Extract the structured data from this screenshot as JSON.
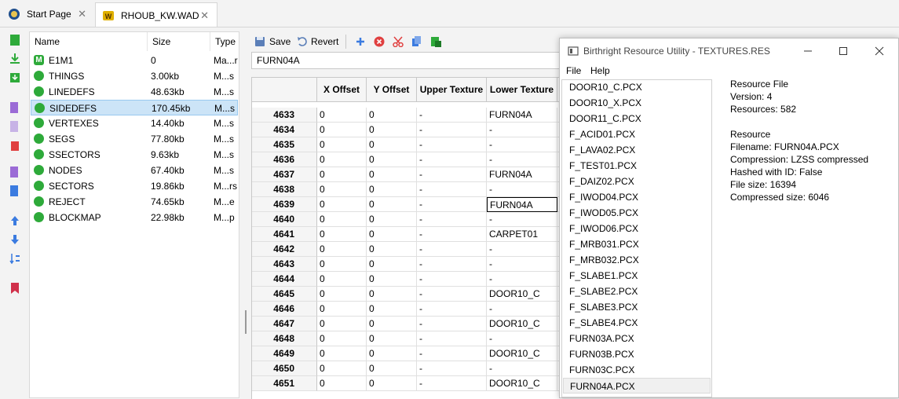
{
  "tabs": [
    {
      "label": "Start Page",
      "close": "✕"
    },
    {
      "label": "RHOUB_KW.WAD",
      "close": "✕"
    }
  ],
  "lumps": {
    "headers": [
      "Name",
      "Size",
      "Type"
    ],
    "items": [
      {
        "name": "E1M1",
        "size": "0",
        "type": "Ma...r",
        "icon": "M"
      },
      {
        "name": "THINGS",
        "size": "3.00kb",
        "type": "M...s"
      },
      {
        "name": "LINEDEFS",
        "size": "48.63kb",
        "type": "M...s"
      },
      {
        "name": "SIDEDEFS",
        "size": "170.45kb",
        "type": "M...s"
      },
      {
        "name": "VERTEXES",
        "size": "14.40kb",
        "type": "M...s"
      },
      {
        "name": "SEGS",
        "size": "77.80kb",
        "type": "M...s"
      },
      {
        "name": "SSECTORS",
        "size": "9.63kb",
        "type": "M...s"
      },
      {
        "name": "NODES",
        "size": "67.40kb",
        "type": "M...s"
      },
      {
        "name": "SECTORS",
        "size": "19.86kb",
        "type": "M...rs"
      },
      {
        "name": "REJECT",
        "size": "74.65kb",
        "type": "M...e"
      },
      {
        "name": "BLOCKMAP",
        "size": "22.98kb",
        "type": "M...p"
      }
    ]
  },
  "editor": {
    "save_label": "Save",
    "revert_label": "Revert",
    "name_value": "FURN04A"
  },
  "grid": {
    "columns": [
      "X Offset",
      "Y Offset",
      "Upper Texture",
      "Lower Texture"
    ],
    "rows": [
      {
        "id": "4633",
        "x": "0",
        "y": "0",
        "upper": "-",
        "lower": "FURN04A"
      },
      {
        "id": "4634",
        "x": "0",
        "y": "0",
        "upper": "-",
        "lower": "-"
      },
      {
        "id": "4635",
        "x": "0",
        "y": "0",
        "upper": "-",
        "lower": "-"
      },
      {
        "id": "4636",
        "x": "0",
        "y": "0",
        "upper": "-",
        "lower": "-"
      },
      {
        "id": "4637",
        "x": "0",
        "y": "0",
        "upper": "-",
        "lower": "FURN04A"
      },
      {
        "id": "4638",
        "x": "0",
        "y": "0",
        "upper": "-",
        "lower": "-"
      },
      {
        "id": "4639",
        "x": "0",
        "y": "0",
        "upper": "-",
        "lower": "FURN04A"
      },
      {
        "id": "4640",
        "x": "0",
        "y": "0",
        "upper": "-",
        "lower": "-"
      },
      {
        "id": "4641",
        "x": "0",
        "y": "0",
        "upper": "-",
        "lower": "CARPET01"
      },
      {
        "id": "4642",
        "x": "0",
        "y": "0",
        "upper": "-",
        "lower": "-"
      },
      {
        "id": "4643",
        "x": "0",
        "y": "0",
        "upper": "-",
        "lower": "-"
      },
      {
        "id": "4644",
        "x": "0",
        "y": "0",
        "upper": "-",
        "lower": "-"
      },
      {
        "id": "4645",
        "x": "0",
        "y": "0",
        "upper": "-",
        "lower": "DOOR10_C"
      },
      {
        "id": "4646",
        "x": "0",
        "y": "0",
        "upper": "-",
        "lower": "-"
      },
      {
        "id": "4647",
        "x": "0",
        "y": "0",
        "upper": "-",
        "lower": "DOOR10_C"
      },
      {
        "id": "4648",
        "x": "0",
        "y": "0",
        "upper": "-",
        "lower": "-"
      },
      {
        "id": "4649",
        "x": "0",
        "y": "0",
        "upper": "-",
        "lower": "DOOR10_C"
      },
      {
        "id": "4650",
        "x": "0",
        "y": "0",
        "upper": "-",
        "lower": "-"
      },
      {
        "id": "4651",
        "x": "0",
        "y": "0",
        "upper": "-",
        "lower": "DOOR10_C"
      }
    ]
  },
  "resource_window": {
    "title": "Birthright Resource Utility - TEXTURES.RES",
    "menu": [
      "File",
      "Help"
    ],
    "files": [
      "DOOR10_C.PCX",
      "DOOR10_X.PCX",
      "DOOR11_C.PCX",
      "F_ACID01.PCX",
      "F_LAVA02.PCX",
      "F_TEST01.PCX",
      "F_DAIZ02.PCX",
      "F_IWOD04.PCX",
      "F_IWOD05.PCX",
      "F_IWOD06.PCX",
      "F_MRB031.PCX",
      "F_MRB032.PCX",
      "F_SLABE1.PCX",
      "F_SLABE2.PCX",
      "F_SLABE3.PCX",
      "F_SLABE4.PCX",
      "FURN03A.PCX",
      "FURN03B.PCX",
      "FURN03C.PCX",
      "FURN04A.PCX"
    ],
    "selected_index": 19,
    "info": [
      "Resource File",
      "Version: 4",
      "Resources: 582",
      "",
      "Resource",
      "Filename: FURN04A.PCX",
      "Compression: LZSS compressed",
      "Hashed with ID: False",
      "File size: 16394",
      "Compressed size: 6046"
    ]
  },
  "colors": {
    "accent_green": "#2eaa3a",
    "selection_blue": "#cce4f7"
  }
}
